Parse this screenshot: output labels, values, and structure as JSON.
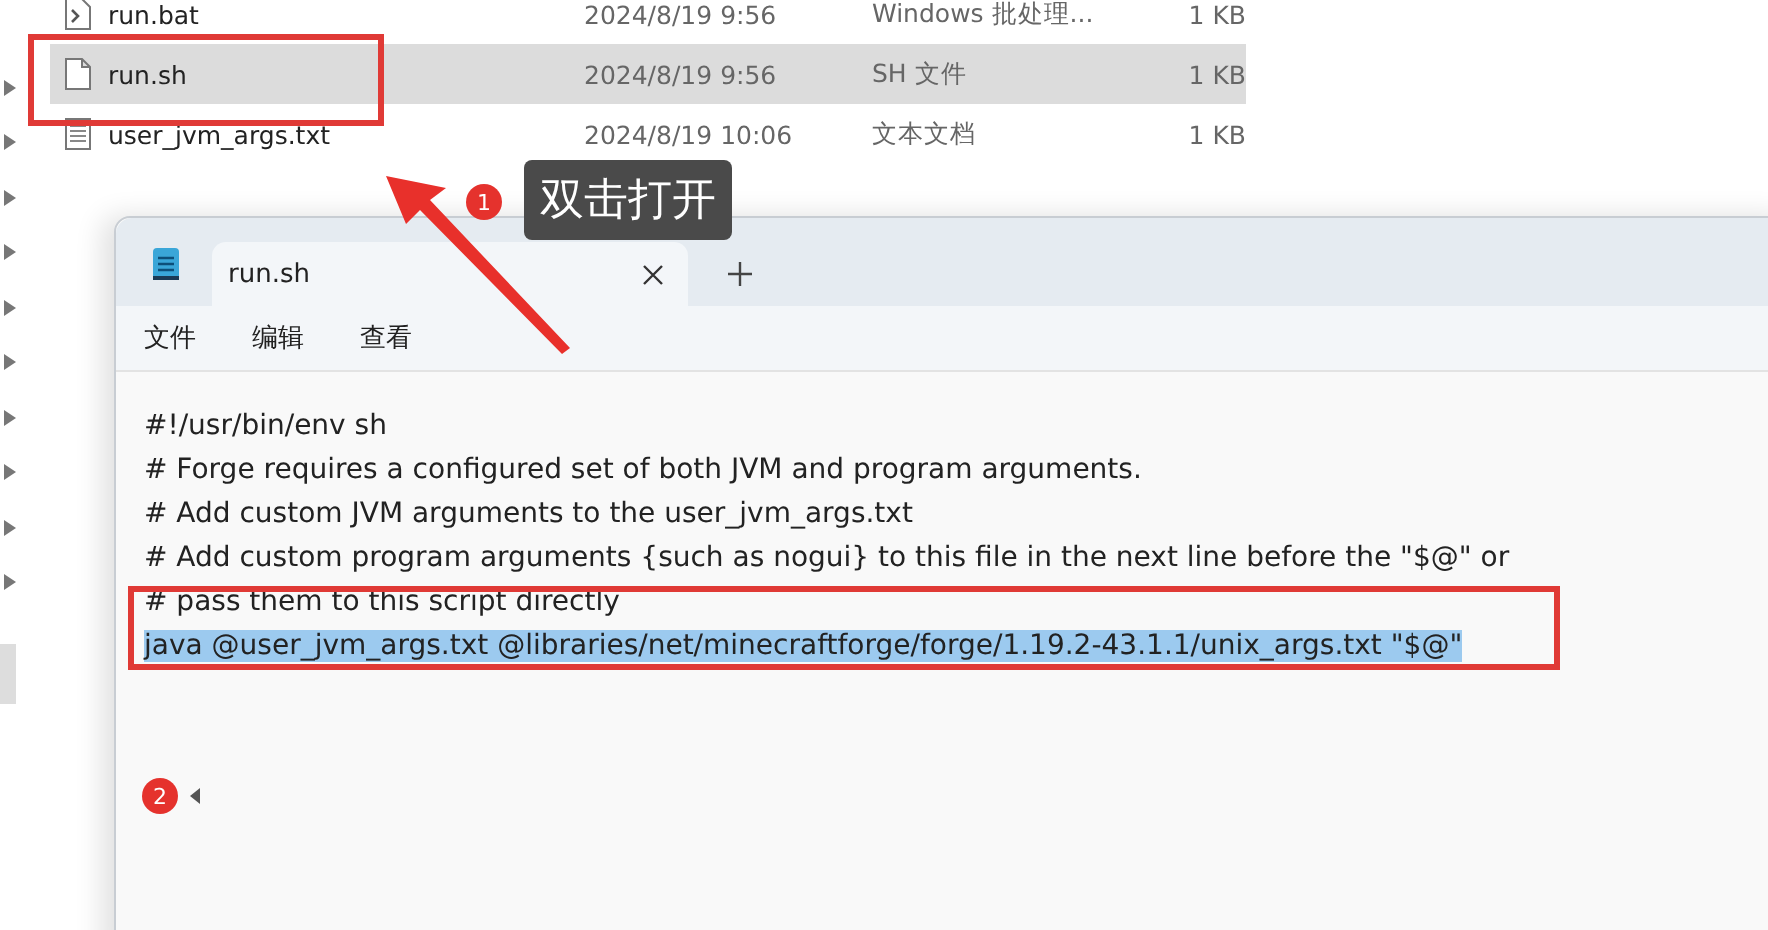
{
  "explorer": {
    "files": [
      {
        "name": "run.bat",
        "date": "2024/8/19 9:56",
        "type": "Windows 批处理...",
        "size": "1 KB",
        "kind": "script",
        "selected": false
      },
      {
        "name": "run.sh",
        "date": "2024/8/19 9:56",
        "type": "SH 文件",
        "size": "1 KB",
        "kind": "file",
        "selected": true
      },
      {
        "name": "user_jvm_args.txt",
        "date": "2024/8/19 10:06",
        "type": "文本文档",
        "size": "1 KB",
        "kind": "text",
        "selected": false
      }
    ]
  },
  "notepad": {
    "tabs": [
      {
        "title": "run.sh",
        "selected": true
      }
    ],
    "menu": [
      "文件",
      "编辑",
      "查看"
    ],
    "lines": [
      {
        "text": "#!/usr/bin/env sh",
        "selected": false
      },
      {
        "text": "# Forge requires a configured set of both JVM and program arguments.",
        "selected": false
      },
      {
        "text": "# Add custom JVM arguments to the user_jvm_args.txt",
        "selected": false
      },
      {
        "text": "# Add custom program arguments {such as nogui} to this file in the next line before the \"$@\" or",
        "selected": false
      },
      {
        "text": "#  pass them to this script directly",
        "selected": false
      },
      {
        "text": "java @user_jvm_args.txt @libraries/net/minecraftforge/forge/1.19.2-43.1.1/unix_args.txt \"$@\"",
        "selected": true
      }
    ]
  },
  "annotations": [
    {
      "number": "1",
      "label": "双击打开"
    },
    {
      "number": "2"
    }
  ]
}
